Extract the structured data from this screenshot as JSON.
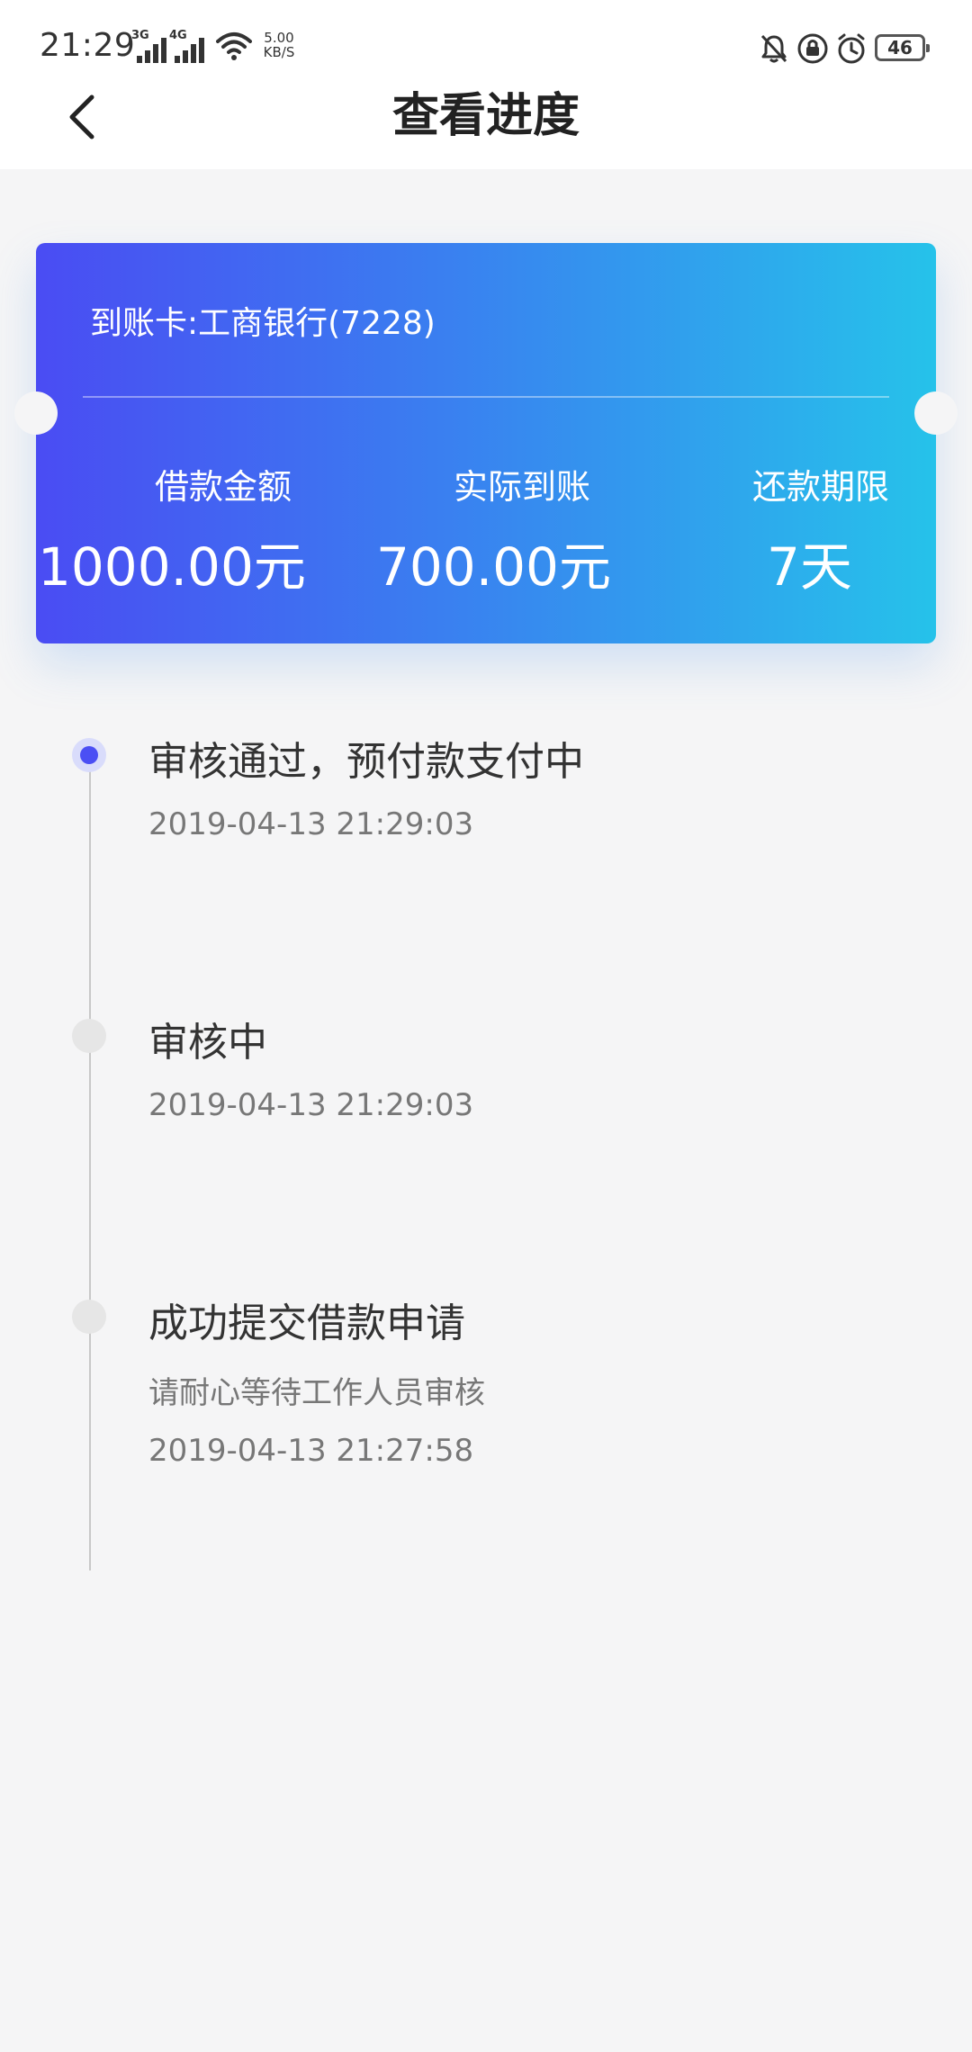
{
  "status_bar": {
    "time": "21:29",
    "network_1": "3G",
    "network_2": "4G",
    "net_speed_value": "5.00",
    "net_speed_unit": "KB/S",
    "battery_level": "46"
  },
  "header": {
    "title": "查看进度"
  },
  "card": {
    "account": "到账卡:工商银行(7228)",
    "columns": [
      {
        "label": "借款金额",
        "value": "1000.00元"
      },
      {
        "label": "实际到账",
        "value": "700.00元"
      },
      {
        "label": "还款期限",
        "value": "7天"
      }
    ],
    "gradient_start": "#4a4cf3",
    "gradient_end": "#26c2ea"
  },
  "timeline": {
    "active_color": "#4b4ff4",
    "steps": [
      {
        "title": "审核通过，预付款支付中",
        "time": "2019-04-13 21:29:03",
        "active": true
      },
      {
        "title": "审核中",
        "time": "2019-04-13 21:29:03",
        "active": false
      },
      {
        "title": "成功提交借款申请",
        "note": "请耐心等待工作人员审核",
        "time": "2019-04-13 21:27:58",
        "active": false
      }
    ]
  }
}
